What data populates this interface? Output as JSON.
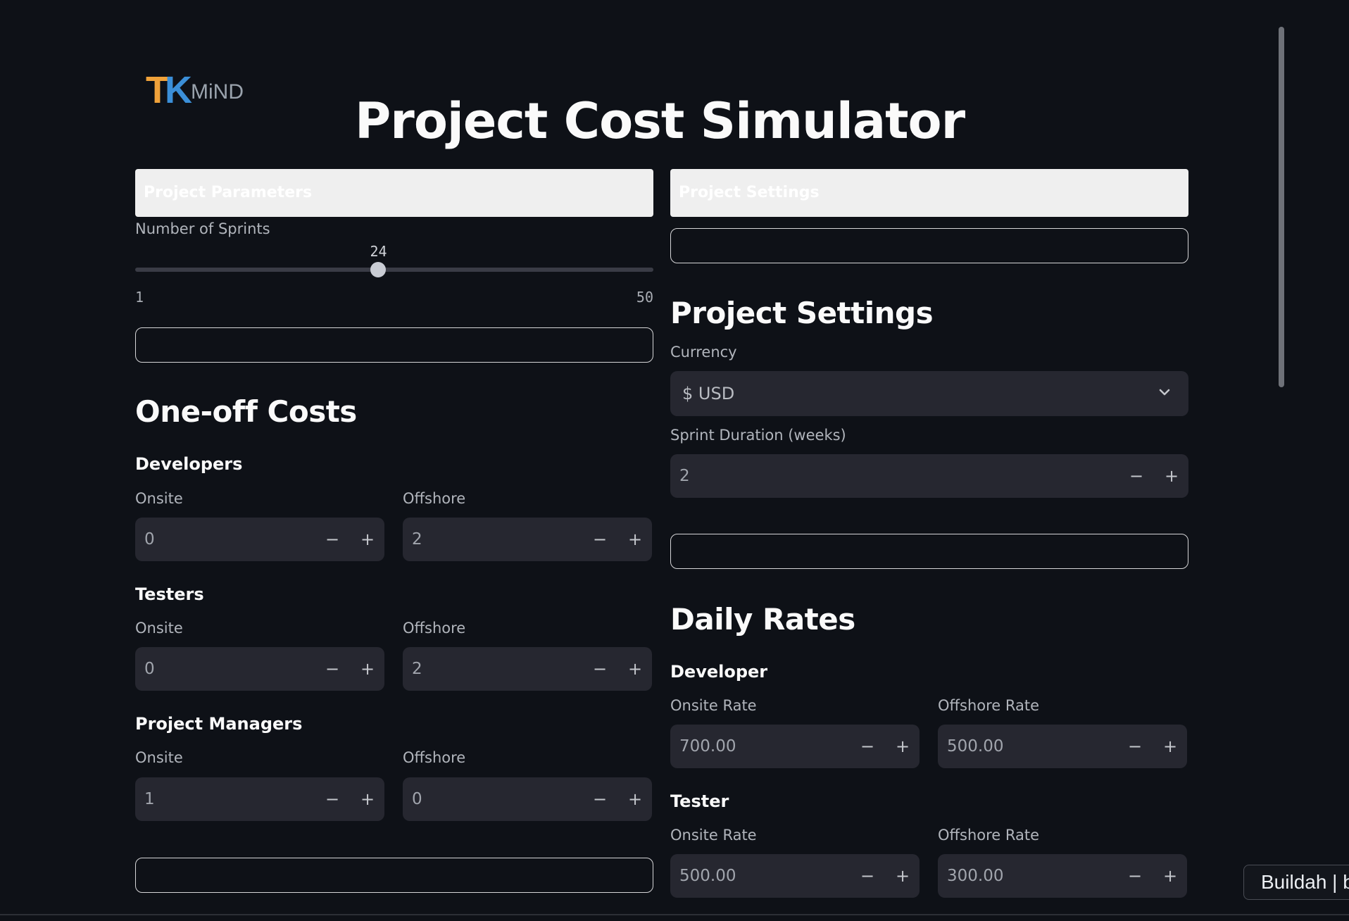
{
  "logo": {
    "tk_t": "T",
    "tk_k": "K",
    "mind": "MiND"
  },
  "page_title": "Project Cost Simulator",
  "left": {
    "panel_header": "Project Parameters",
    "sprints_label": "Number of Sprints",
    "sprints_value": "24",
    "sprints_current": 24,
    "sprints_min": "1",
    "sprints_max": "50",
    "sprints_range": [
      1,
      50
    ],
    "one_off_title": "One-off Costs",
    "developers": {
      "title": "Developers",
      "onsite_label": "Onsite",
      "onsite_value": "0",
      "offshore_label": "Offshore",
      "offshore_value": "2"
    },
    "testers": {
      "title": "Testers",
      "onsite_label": "Onsite",
      "onsite_value": "0",
      "offshore_label": "Offshore",
      "offshore_value": "2"
    },
    "project_managers": {
      "title": "Project Managers",
      "onsite_label": "Onsite",
      "onsite_value": "1",
      "offshore_label": "Offshore",
      "offshore_value": "0"
    }
  },
  "right": {
    "panel_header": "Project Settings",
    "settings_title": "Project Settings",
    "currency_label": "Currency",
    "currency_value": "$ USD",
    "sprint_duration_label": "Sprint Duration (weeks)",
    "sprint_duration_value": "2",
    "daily_rates_title": "Daily Rates",
    "developer": {
      "title": "Developer",
      "onsite_label": "Onsite Rate",
      "onsite_value": "700.00",
      "offshore_label": "Offshore Rate",
      "offshore_value": "500.00"
    },
    "tester": {
      "title": "Tester",
      "onsite_label": "Onsite Rate",
      "onsite_value": "500.00",
      "offshore_label": "Offshore Rate",
      "offshore_value": "300.00"
    }
  },
  "stepper": {
    "minus": "−",
    "plus": "+"
  },
  "toast": "Buildah | b",
  "colors": {
    "background": "#0e1117",
    "input_bg": "#262730",
    "panel_header_bg": "#efefef",
    "logo_orange": "#f0a23a",
    "logo_blue": "#3b8fd8"
  },
  "icons": {
    "select_arrow": "chevron-down-icon"
  }
}
